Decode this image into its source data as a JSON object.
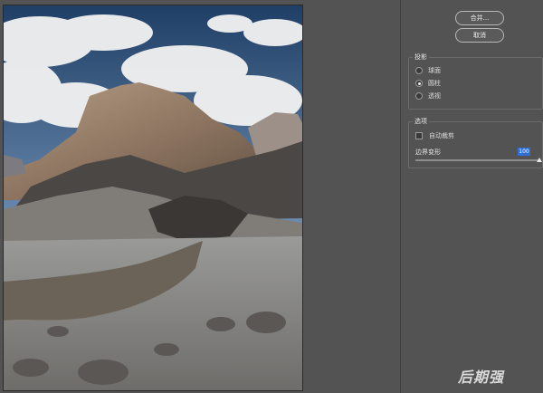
{
  "buttons": {
    "merge_label": "合并...",
    "cancel_label": "取消"
  },
  "projection": {
    "title": "投影",
    "options": [
      {
        "label": "球面",
        "selected": false
      },
      {
        "label": "圆柱",
        "selected": true
      },
      {
        "label": "透视",
        "selected": false
      }
    ]
  },
  "options": {
    "title": "选项",
    "auto_crop_label": "自动裁剪",
    "auto_crop_checked": false,
    "boundary_warp_label": "边界变形",
    "boundary_warp_value": "100"
  },
  "watermark": "后期强"
}
